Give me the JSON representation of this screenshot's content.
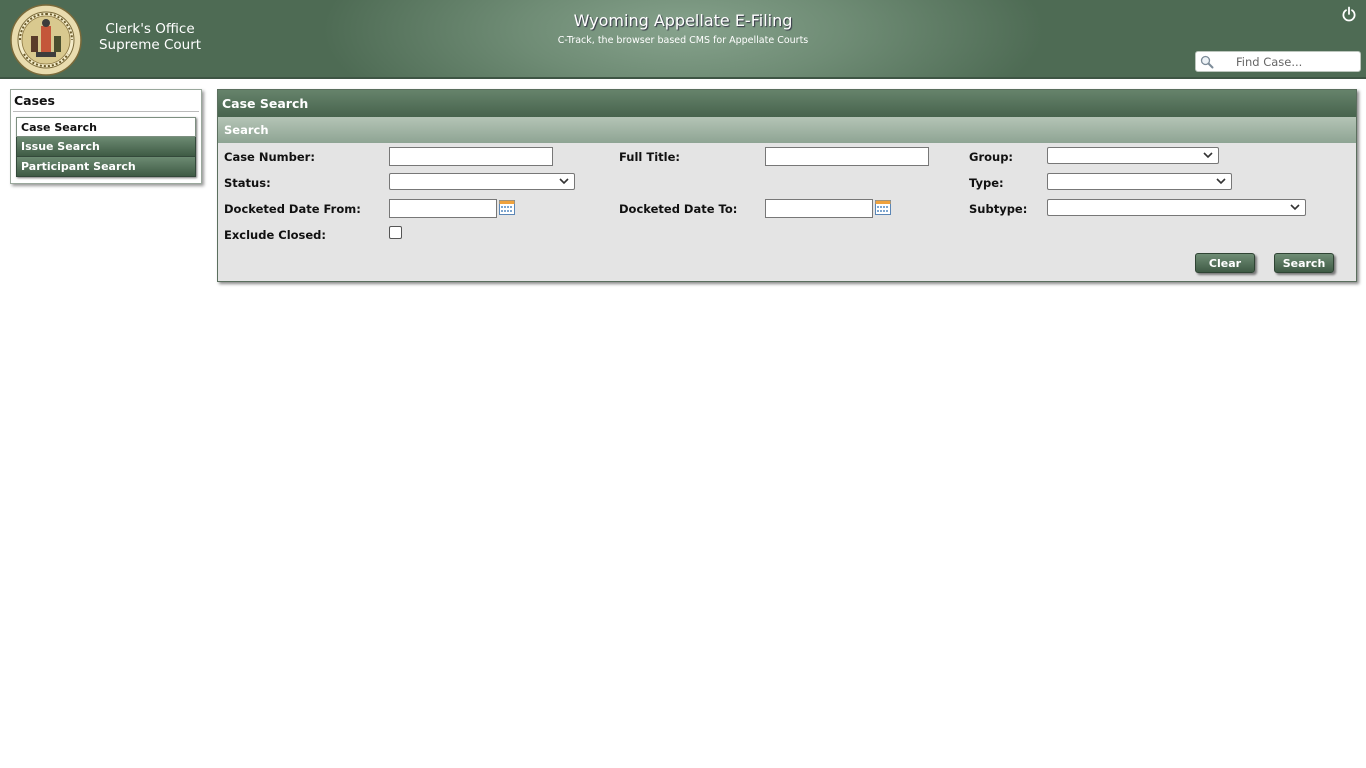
{
  "header": {
    "office_line1": "Clerk's Office",
    "office_line2": "Supreme Court",
    "app_title": "Wyoming Appellate E-Filing",
    "app_subtitle": "C-Track, the browser based CMS for Appellate Courts",
    "find_placeholder": "Find Case...",
    "seal_icon": "wyoming-state-seal",
    "power_icon": "power-icon"
  },
  "sidebar": {
    "title": "Cases",
    "items": [
      {
        "label": "Case Search",
        "active": true
      },
      {
        "label": "Issue Search",
        "active": false
      },
      {
        "label": "Participant Search",
        "active": false
      }
    ]
  },
  "panel": {
    "title": "Case Search",
    "section": "Search",
    "fields": {
      "case_number": {
        "label": "Case Number:",
        "value": ""
      },
      "full_title": {
        "label": "Full Title:",
        "value": ""
      },
      "group": {
        "label": "Group:",
        "value": ""
      },
      "status": {
        "label": "Status:",
        "value": ""
      },
      "type": {
        "label": "Type:",
        "value": ""
      },
      "docketed_from": {
        "label": "Docketed Date From:",
        "value": ""
      },
      "docketed_to": {
        "label": "Docketed Date To:",
        "value": ""
      },
      "subtype": {
        "label": "Subtype:",
        "value": ""
      },
      "exclude_closed": {
        "label": "Exclude Closed:",
        "checked": false
      }
    },
    "buttons": {
      "clear": "Clear",
      "search": "Search"
    }
  },
  "colors": {
    "header_green": "#5f7c65",
    "button_green": "#4a6650",
    "panel_bg": "#e4e4e4"
  }
}
